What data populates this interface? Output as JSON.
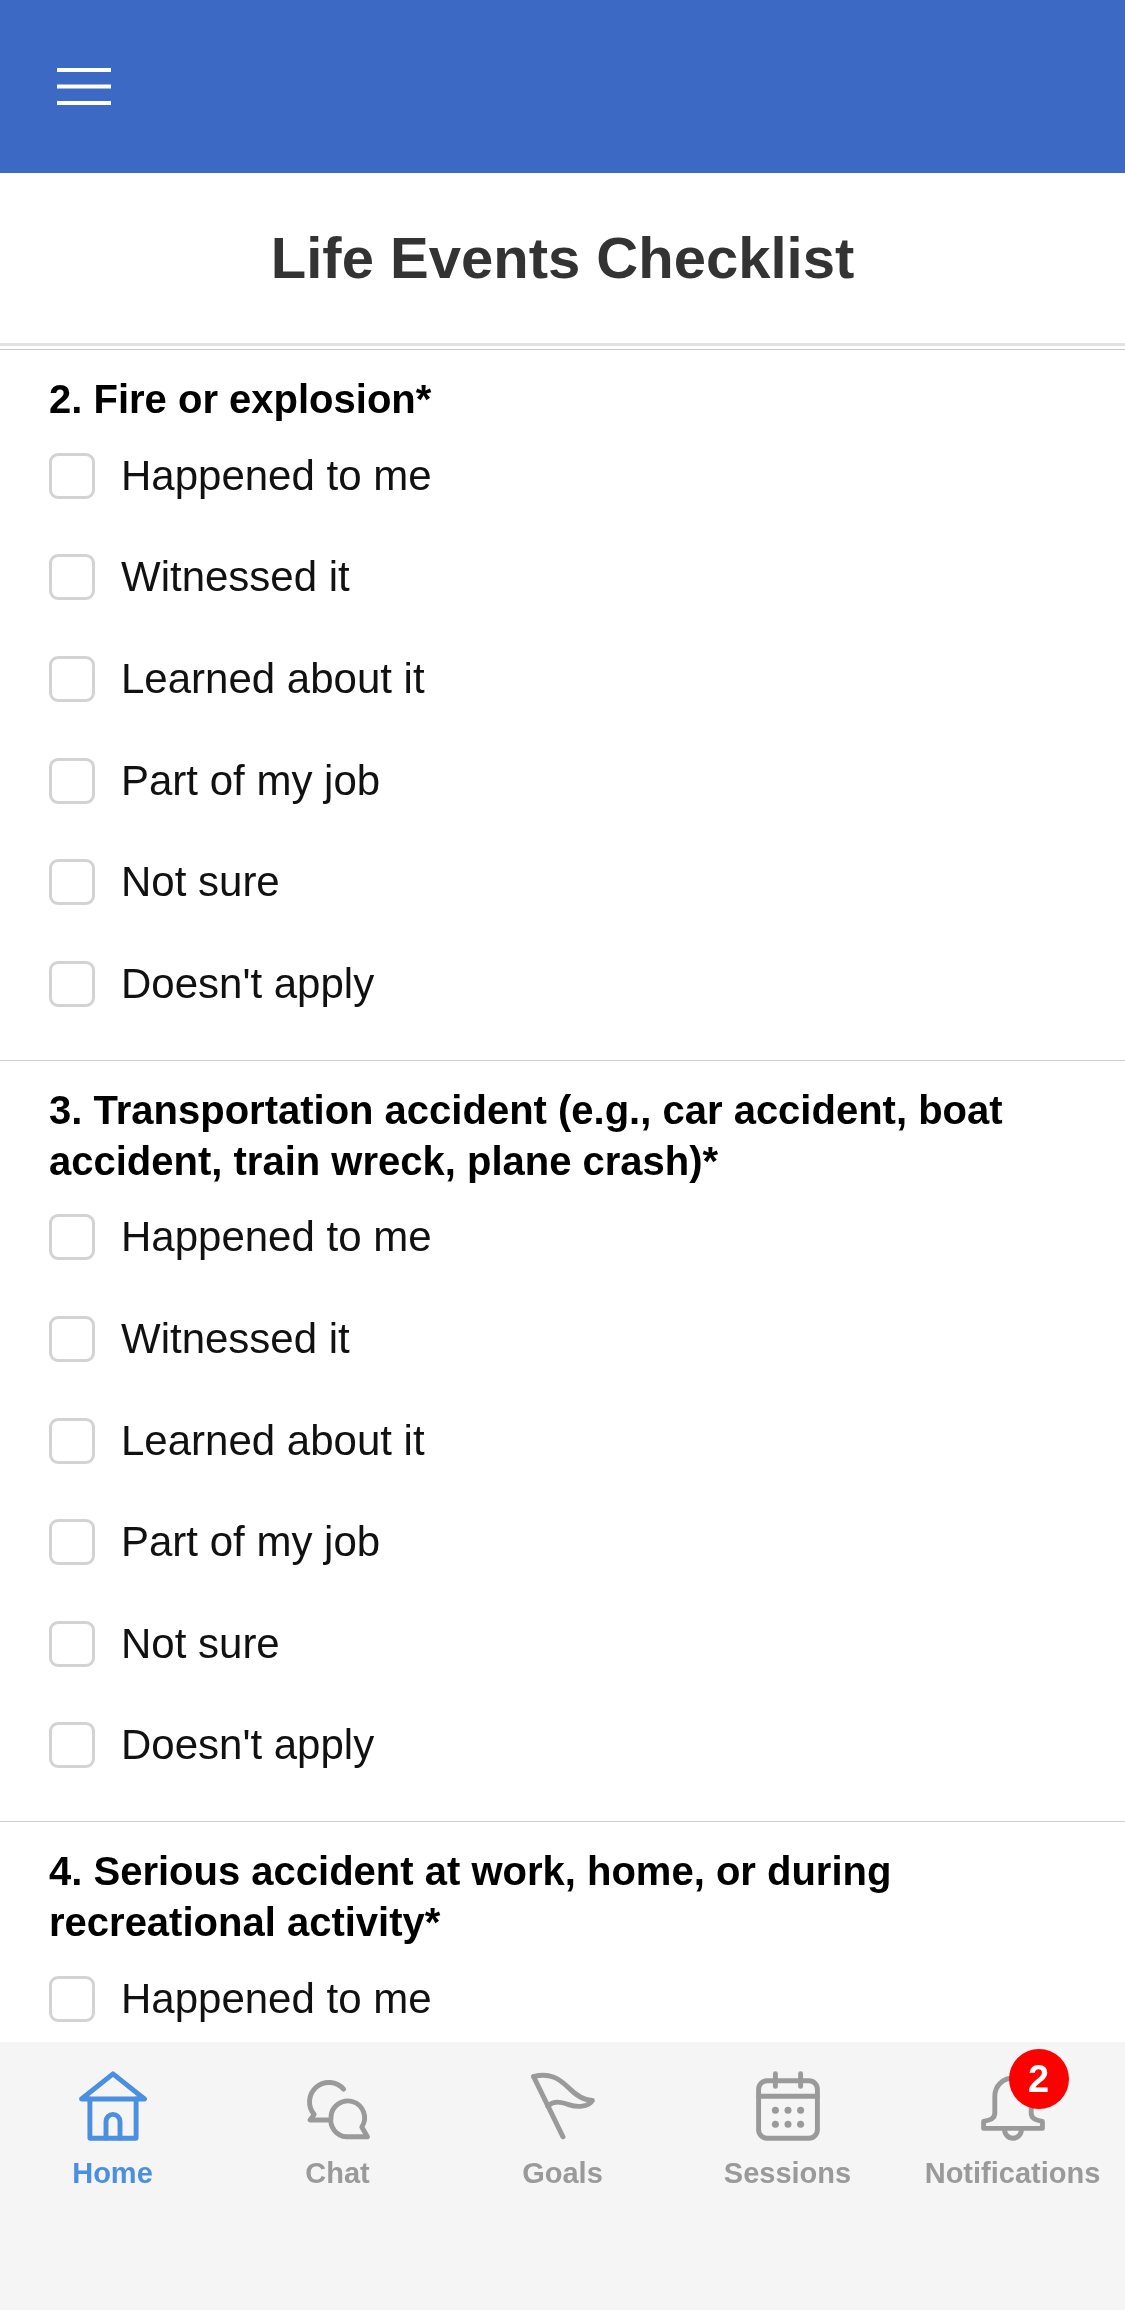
{
  "page_title": "Life Events Checklist",
  "questions": [
    {
      "title": "2. Fire or explosion*",
      "options": [
        {
          "label": "Happened to me",
          "checked": false
        },
        {
          "label": "Witnessed it",
          "checked": false
        },
        {
          "label": "Learned about it",
          "checked": false
        },
        {
          "label": "Part of my job",
          "checked": false
        },
        {
          "label": "Not sure",
          "checked": false
        },
        {
          "label": "Doesn't apply",
          "checked": false
        }
      ]
    },
    {
      "title": "3. Transportation accident (e.g., car accident, boat accident, train wreck, plane crash)*",
      "options": [
        {
          "label": "Happened to me",
          "checked": false
        },
        {
          "label": "Witnessed it",
          "checked": false
        },
        {
          "label": "Learned about it",
          "checked": false
        },
        {
          "label": "Part of my job",
          "checked": false
        },
        {
          "label": "Not sure",
          "checked": false
        },
        {
          "label": "Doesn't apply",
          "checked": false
        }
      ]
    },
    {
      "title": "4. Serious accident at work, home, or during recreational activity*",
      "options": [
        {
          "label": "Happened to me",
          "checked": false
        }
      ]
    }
  ],
  "tab_bar": [
    {
      "label": "Home",
      "selected": true
    },
    {
      "label": "Chat",
      "selected": false
    },
    {
      "label": "Goals",
      "selected": false
    },
    {
      "label": "Sessions",
      "selected": false
    },
    {
      "label": "Notifications",
      "selected": false,
      "badge": "2"
    }
  ]
}
